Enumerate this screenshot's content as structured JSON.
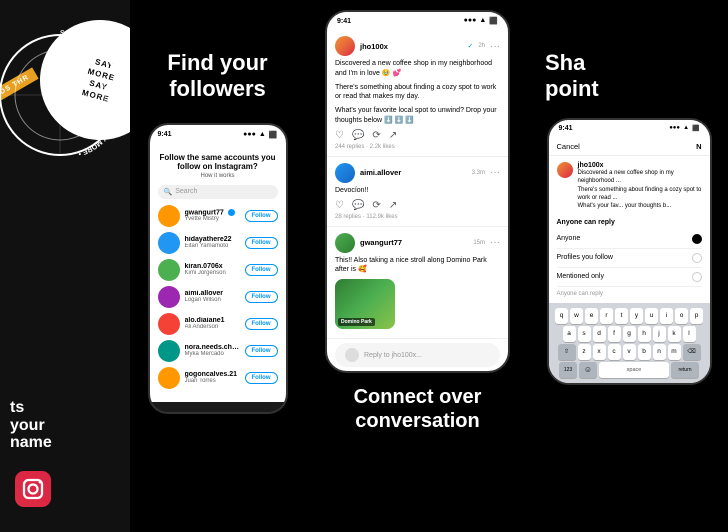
{
  "panel1": {
    "bottom_text_line1": "ts",
    "bottom_text_line2": "your",
    "bottom_text_line3": "name",
    "badge_text": "SAY\nMORE",
    "threads_label": "ADS THR"
  },
  "panel2": {
    "title_line1": "Find your",
    "title_line2": "followers",
    "phone": {
      "status_time": "9:41",
      "header": "Follow the same accounts you follow on Instagram?",
      "subheader": "How it works",
      "search_placeholder": "Search",
      "users": [
        {
          "username": "gwangurt77",
          "displayname": "Yvette Mistry",
          "verified": true,
          "color": "orange"
        },
        {
          "username": "hidayathere22",
          "displayname": "Eitan Yamamoto",
          "verified": false,
          "color": "blue"
        },
        {
          "username": "kiran.0706x",
          "displayname": "Kimi Jorgenson",
          "verified": false,
          "color": "green"
        },
        {
          "username": "aimi.allover",
          "displayname": "Logan Wilson",
          "verified": false,
          "color": "purple"
        },
        {
          "username": "alo.diaiane1",
          "displayname": "Ali Anderson",
          "verified": false,
          "color": "red"
        },
        {
          "username": "nora.needs.cheese",
          "displayname": "Myka Mercado",
          "verified": false,
          "color": "teal"
        },
        {
          "username": "gogoncalves.21",
          "displayname": "Juan Torres",
          "verified": false,
          "color": "orange"
        }
      ],
      "follow_label": "Follow"
    }
  },
  "panel3": {
    "title_line1": "Connect over",
    "title_line2": "conversation",
    "phone": {
      "post1": {
        "username": "jho100x",
        "verified": true,
        "time": "2h",
        "text1": "Discovered a new coffee shop in my neighborhood and I'm in love 🥹 💕",
        "text2": "There's something about finding a cozy spot to work or read that makes my day.",
        "text3": "What's your favorite local spot to unwind? Drop your thoughts below ⬇️ ⬇️ ⬇️",
        "stats": "244 replies · 2.2k likes"
      },
      "post2": {
        "username": "aimi.allover",
        "time": "3.3m",
        "text": "Devocíon!!",
        "stats": "28 replies · 112.9k likes"
      },
      "post3": {
        "username": "gwangurt77",
        "time": "15m",
        "text": "This!! Also taking a nice stroll along Domino Park after is 🥰",
        "has_image": true
      },
      "reply_placeholder": "Reply to jho100x..."
    }
  },
  "panel4": {
    "title_line1": "Sha",
    "title_line2": "point",
    "phone": {
      "status_time": "9:41",
      "cancel_label": "Cancel",
      "new_label": "N",
      "post_username": "jho100x",
      "post_text1": "Discovered a new coffee shop in my neighborhood ...",
      "post_text2": "There's something about finding a cozy spot to work or read ...",
      "post_text3": "What's your fav... your thoughts b...",
      "reply_label": "Anyone can reply",
      "audience_options": [
        {
          "label": "Anyone",
          "selected": true
        },
        {
          "label": "Profiles you follow",
          "selected": false
        },
        {
          "label": "Mentioned only",
          "selected": false
        }
      ],
      "anyone_can_reply": "Anyone can reply",
      "keyboard_rows": [
        [
          "q",
          "w",
          "e",
          "r",
          "t",
          "y",
          "u",
          "i",
          "o",
          "p"
        ],
        [
          "a",
          "s",
          "d",
          "f",
          "g",
          "h",
          "j",
          "k",
          "l"
        ],
        [
          "z",
          "x",
          "c",
          "v",
          "b",
          "n",
          "m"
        ]
      ]
    }
  }
}
